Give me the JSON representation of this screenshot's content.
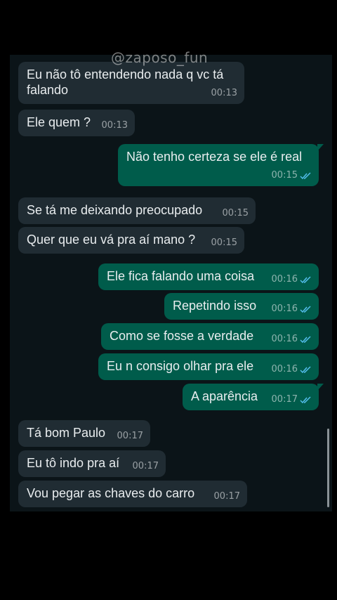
{
  "watermark": "@zaposo_fun",
  "messages": [
    {
      "dir": "in",
      "text": "Eu não tô entendendo nada q vc tá",
      "text2": "falando",
      "time": "00:13"
    },
    {
      "dir": "in",
      "text": "Ele quem ?",
      "time": "00:13"
    },
    {
      "dir": "out",
      "text": "Não tenho certeza se ele é real",
      "time": "00:15",
      "status": "read"
    },
    {
      "dir": "in",
      "text": "Se tá me deixando preocupado",
      "time": "00:15"
    },
    {
      "dir": "in",
      "text": "Quer que eu vá pra aí mano ?",
      "time": "00:15"
    },
    {
      "dir": "out",
      "text": "Ele fica falando uma coisa",
      "time": "00:16",
      "status": "read"
    },
    {
      "dir": "out",
      "text": "Repetindo isso",
      "time": "00:16",
      "status": "read"
    },
    {
      "dir": "out",
      "text": "Como se fosse a verdade",
      "time": "00:16",
      "status": "read"
    },
    {
      "dir": "out",
      "text": "Eu n consigo olhar pra ele",
      "time": "00:16",
      "status": "read"
    },
    {
      "dir": "out",
      "text": "A aparência",
      "time": "00:17",
      "status": "read"
    },
    {
      "dir": "in",
      "text": "Tá bom Paulo",
      "time": "00:17"
    },
    {
      "dir": "in",
      "text": "Eu tô indo pra aí",
      "time": "00:17"
    },
    {
      "dir": "in",
      "text": "Vou pegar as chaves do carro",
      "time": "00:17"
    }
  ],
  "colors": {
    "incoming": "#202c33",
    "outgoing": "#005c4b",
    "read_ticks": "#53bdeb",
    "background": "#0b1418"
  }
}
